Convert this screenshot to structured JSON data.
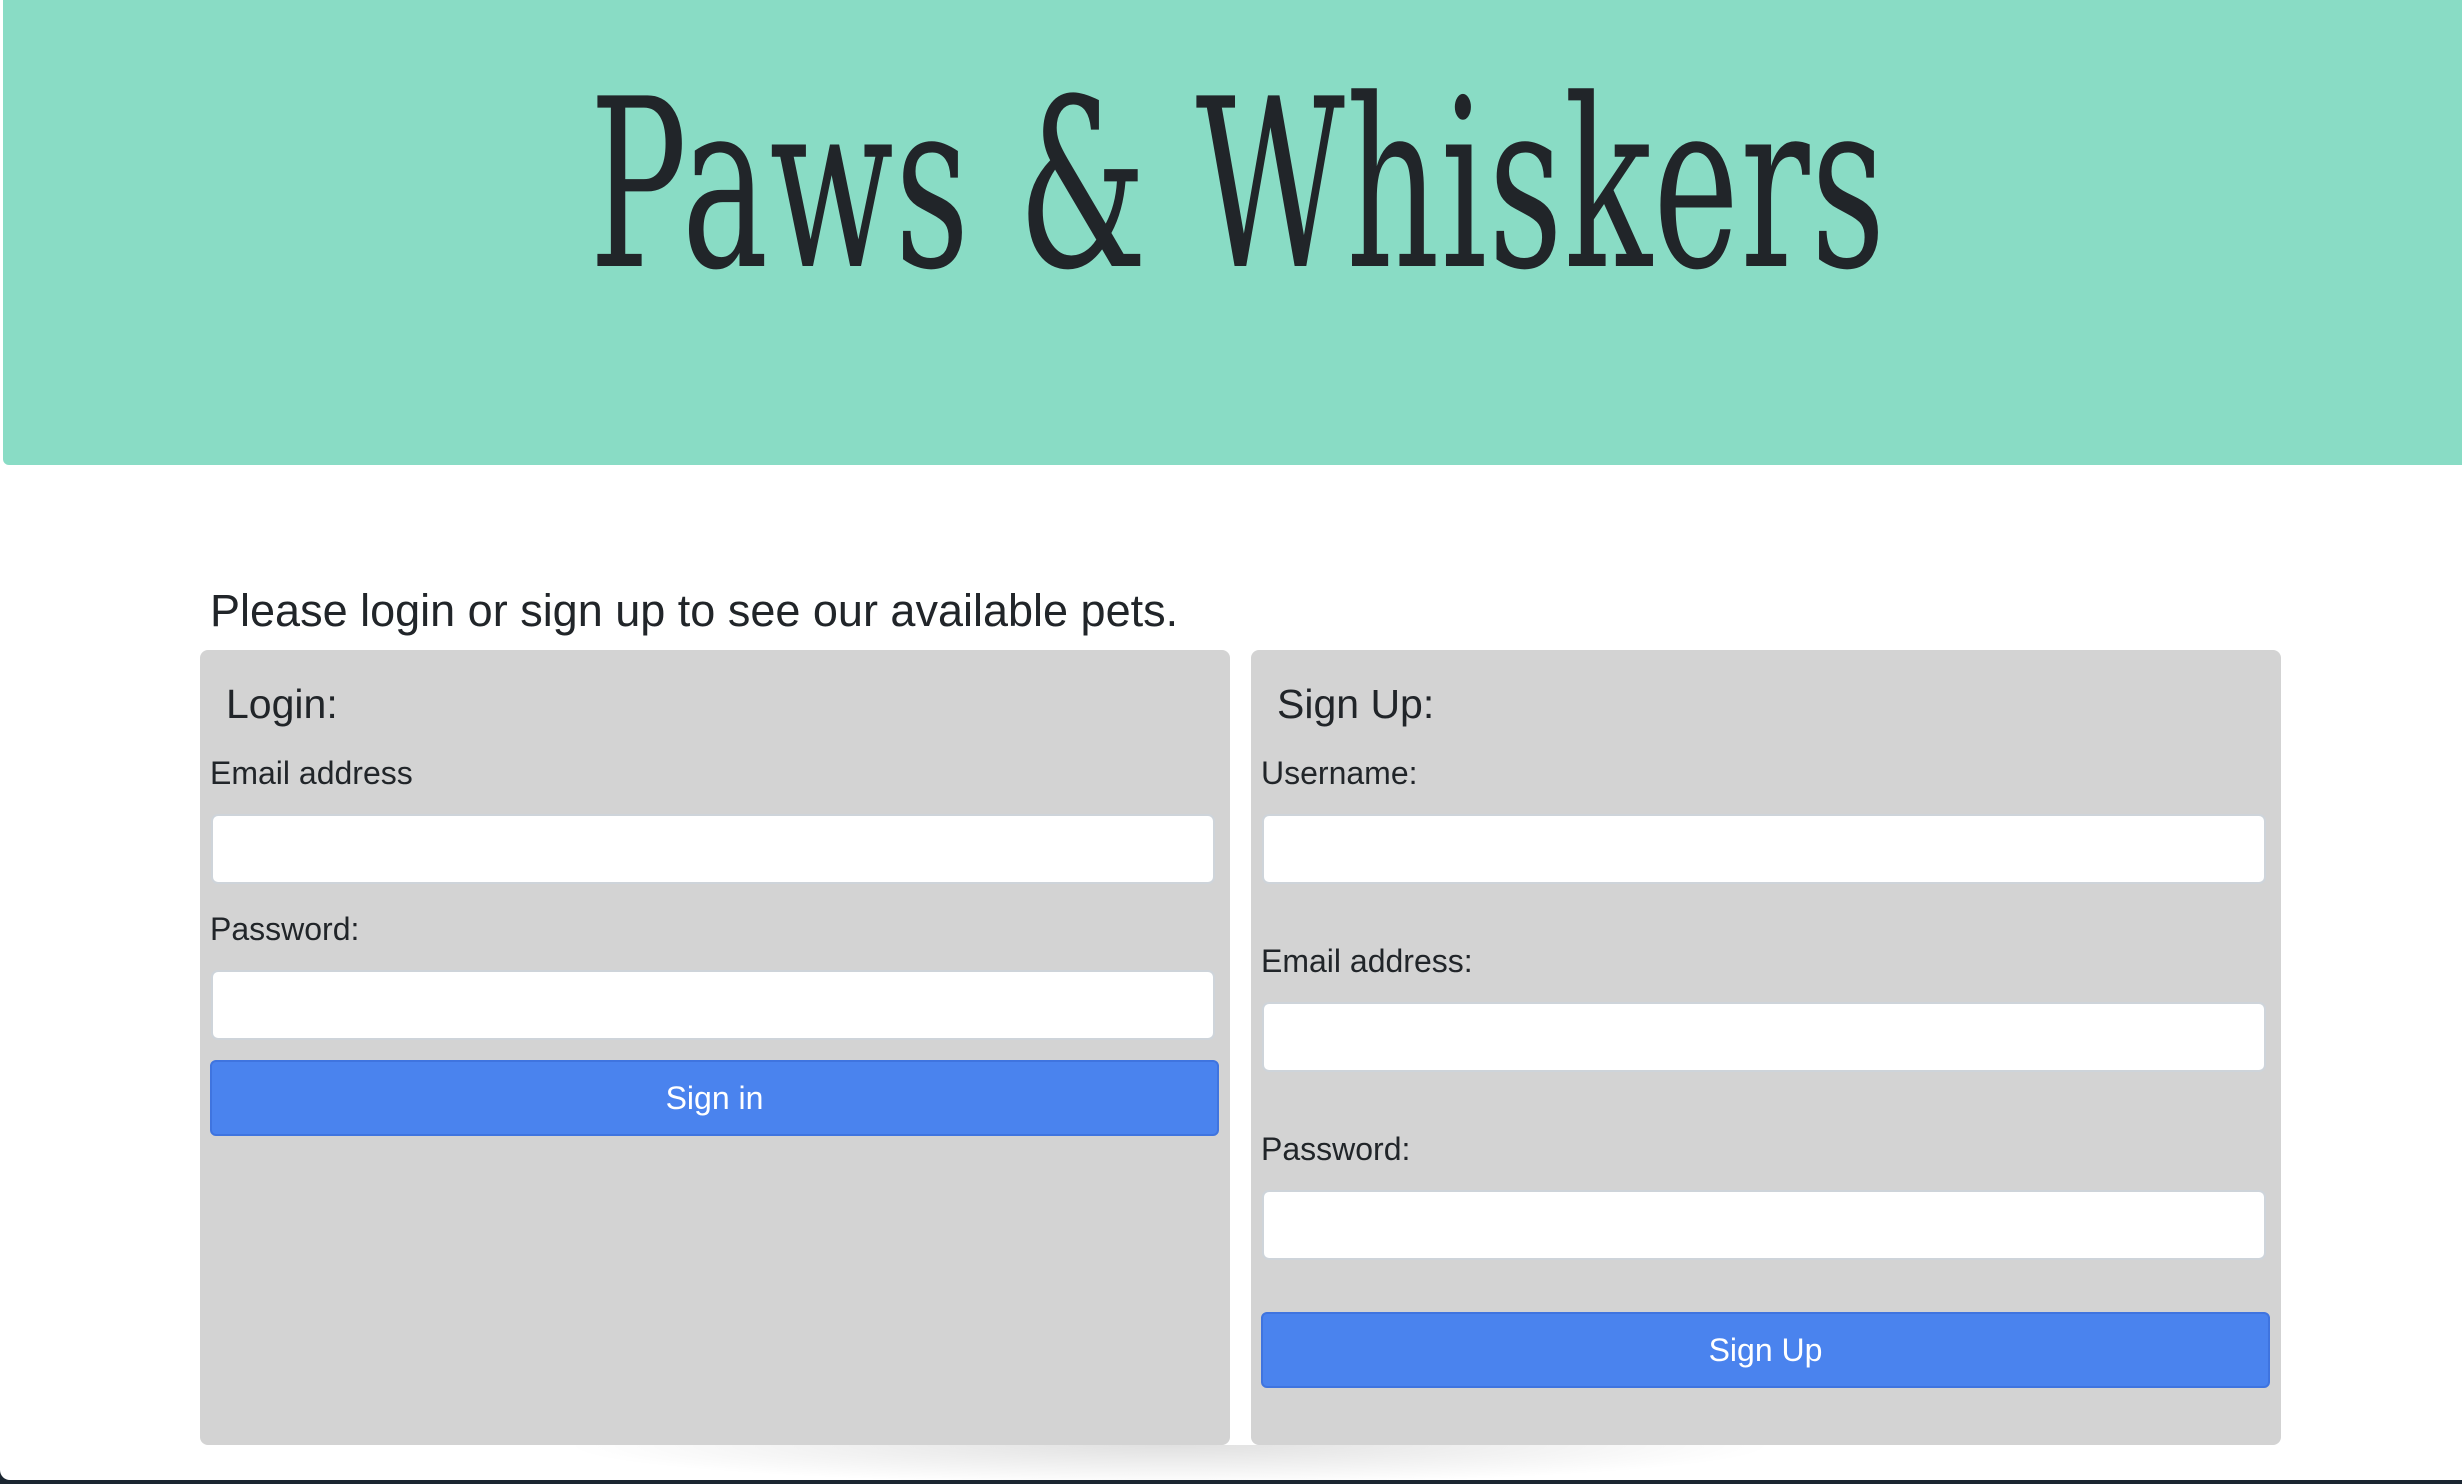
{
  "colors": {
    "hero_background": "#89dcc5",
    "card_background": "#d3d3d3",
    "button_background": "#4a83ee"
  },
  "header": {
    "title": "Paws & Whiskers"
  },
  "main": {
    "intro_text": "Please login or sign up to see our available pets."
  },
  "login": {
    "title": "Login:",
    "email_label": "Email address",
    "email_value": "",
    "password_label": "Password:",
    "password_value": "",
    "submit_label": "Sign in"
  },
  "signup": {
    "title": "Sign Up:",
    "username_label": "Username:",
    "username_value": "",
    "email_label": "Email address:",
    "email_value": "",
    "password_label": "Password:",
    "password_value": "",
    "submit_label": "Sign Up"
  }
}
